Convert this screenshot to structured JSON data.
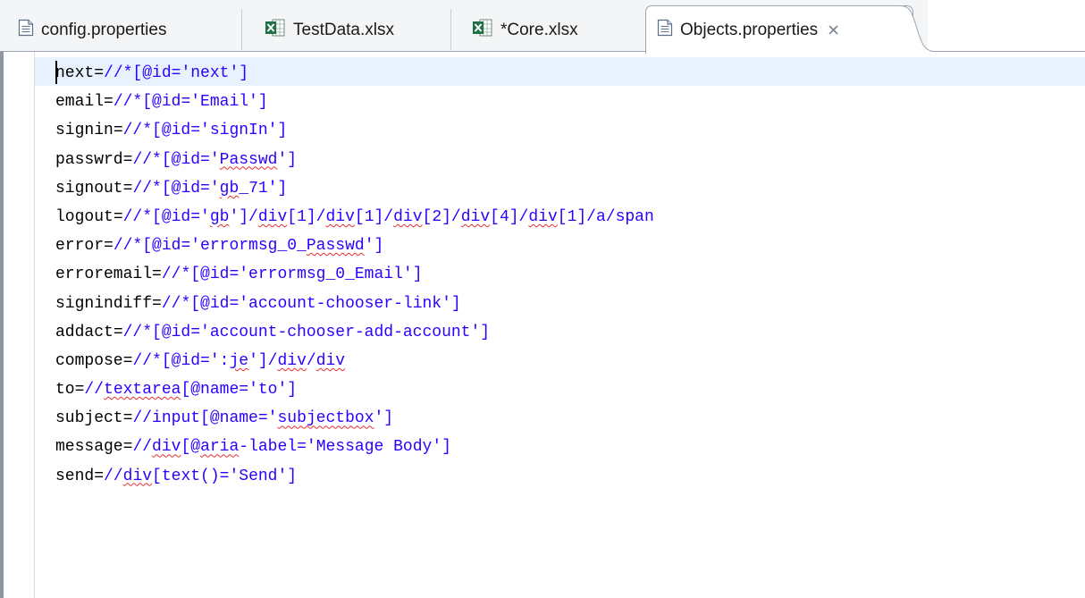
{
  "tabs": [
    {
      "label": "config.properties",
      "icon": "properties-file-icon",
      "active": false
    },
    {
      "label": "TestData.xlsx",
      "icon": "excel-file-icon",
      "active": false
    },
    {
      "label": "*Core.xlsx",
      "icon": "excel-file-icon",
      "active": false
    },
    {
      "label": "Objects.properties",
      "icon": "properties-file-icon",
      "active": true,
      "close_glyph": "✕"
    }
  ],
  "editor": {
    "lines": [
      "next=//*[@id='next']",
      "email=//*[@id='Email']",
      "signin=//*[@id='signIn']",
      "passwrd=//*[@id='Passwd']",
      "signout=//*[@id='gb_71']",
      "logout=//*[@id='gb']/div[1]/div[1]/div[2]/div[4]/div[1]/a/span",
      "error=//*[@id='errormsg_0_Passwd']",
      "erroremail=//*[@id='errormsg_0_Email']",
      "signindiff=//*[@id='account-chooser-link']",
      "addact=//*[@id='account-chooser-add-account']",
      "compose=//*[@id=':je']/div/div",
      "to=//textarea[@name='to']",
      "subject=//input[@name='subjectbox']",
      "message=//div[@aria-label='Message Body']",
      "send=//div[text()='Send']"
    ],
    "spellcheck_words": [
      "Passwd",
      "gb",
      "div",
      "je",
      "textarea",
      "subjectbox",
      "aria"
    ]
  },
  "colors": {
    "key": "#000000",
    "value": "#2a00ff",
    "squiggle": "#e4302f",
    "current_line": "#e8f2fe",
    "excel_green": "#1e7145"
  }
}
